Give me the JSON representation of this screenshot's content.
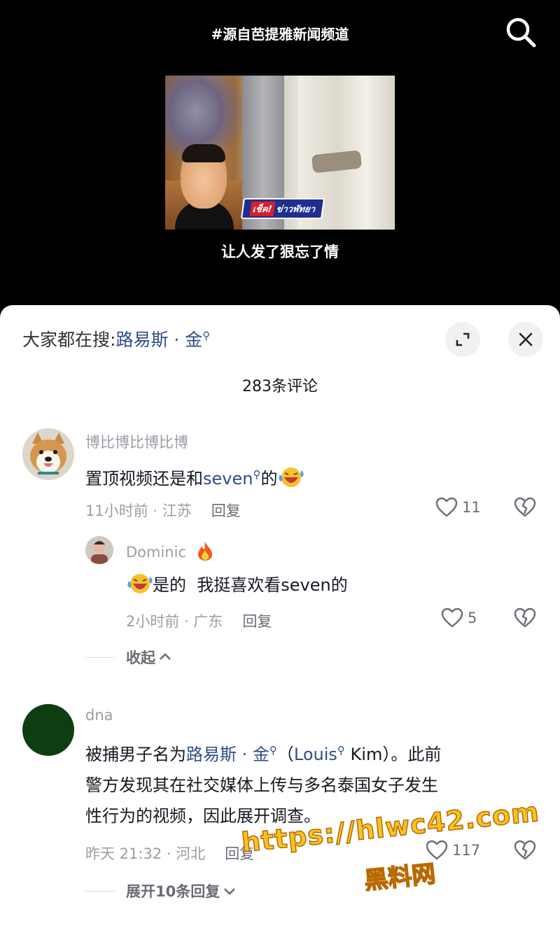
{
  "video": {
    "channel_tag": "#源自芭提雅新闻频道",
    "caption": "让人发了狠忘了情",
    "thumbnail_logo_red": "เช็ค!",
    "thumbnail_logo_blue": "ข่าวพัทยา"
  },
  "sheet": {
    "search_prefix": "大家都在搜:",
    "search_keyword": "路易斯 · 金",
    "comment_count": "283条评论"
  },
  "comments": [
    {
      "username": "博比博比博比博",
      "text_before": "置顶视频还是和",
      "mention": "seven",
      "text_after": "的",
      "time_location": "11小时前 · 江苏",
      "reply_label": "回复",
      "likes": "11",
      "replies": [
        {
          "username": "Dominic",
          "text": "是的  我挺喜欢看seven的",
          "time_location": "2小时前 · 广东",
          "reply_label": "回复",
          "likes": "5"
        }
      ],
      "toggle_label": "收起"
    },
    {
      "username": "dna",
      "text_line1_before": "被捕男子名为",
      "mention1": "路易斯 · 金",
      "paren_open": "（",
      "mention2": "Louis",
      "text_line1_after": " Kim）。此前",
      "text_line2": "警方发现其在社交媒体上传与多名泰国女子发生",
      "text_line3": "性行为的视频，因此展开调查。",
      "time_location": "昨天 21:32 · 河北",
      "reply_label": "回复",
      "likes": "117",
      "toggle_label": "展开10条回复"
    }
  ],
  "watermark": {
    "url": "https://hlwc42.com",
    "name": "黑料网"
  },
  "colors": {
    "mention": "#2d4f8a",
    "watermark": "#f7c325"
  }
}
